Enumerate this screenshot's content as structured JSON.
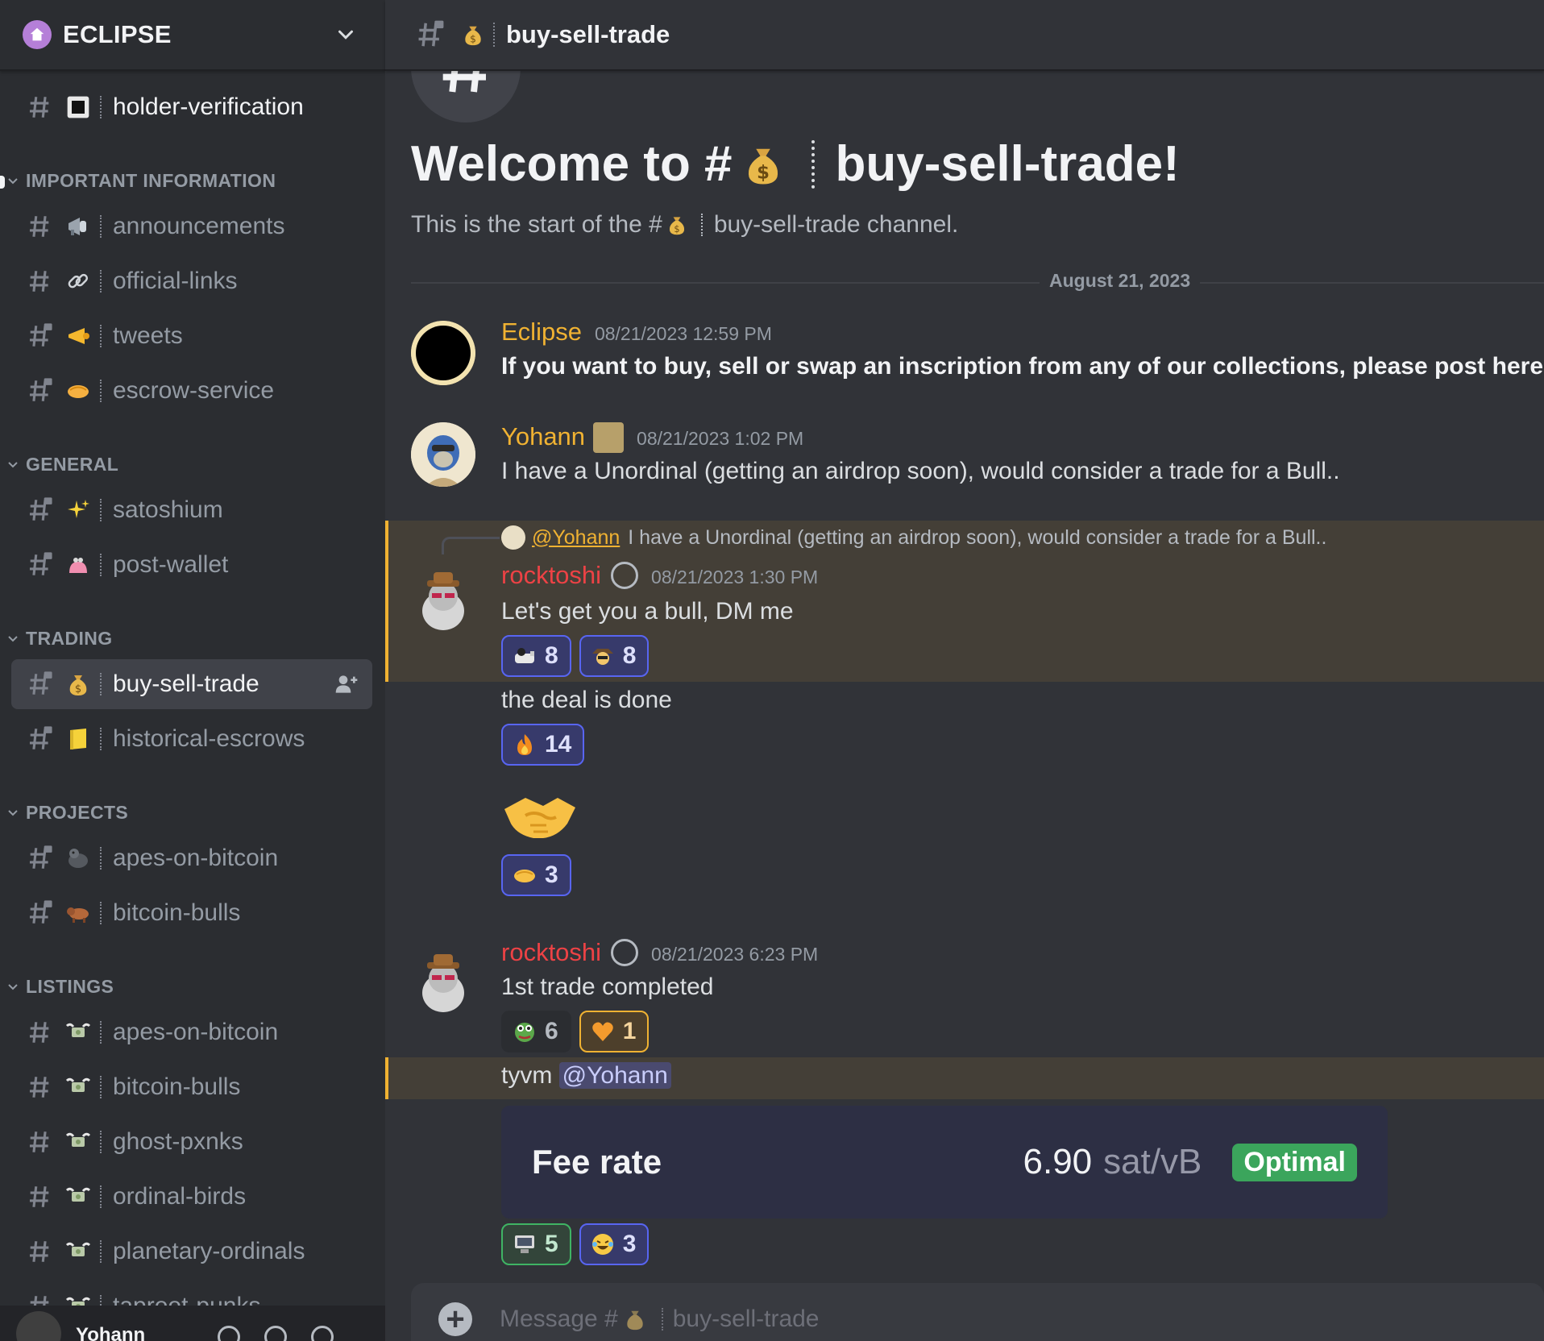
{
  "server": {
    "name": "ECLIPSE"
  },
  "sidebar": {
    "top_channel": {
      "label": "holder-verification"
    },
    "categories": [
      {
        "label": "IMPORTANT INFORMATION",
        "channels": [
          {
            "label": "announcements",
            "icon": "megaphone-icon"
          },
          {
            "label": "official-links",
            "icon": "link-icon"
          },
          {
            "label": "tweets",
            "icon": "horn-icon"
          },
          {
            "label": "escrow-service",
            "icon": "handshake-icon"
          }
        ]
      },
      {
        "label": "GENERAL",
        "channels": [
          {
            "label": "satoshium",
            "icon": "sparkles-icon"
          },
          {
            "label": "post-wallet",
            "icon": "purse-icon"
          }
        ]
      },
      {
        "label": "TRADING",
        "channels": [
          {
            "label": "buy-sell-trade",
            "icon": "money-bag-icon",
            "active": true
          },
          {
            "label": "historical-escrows",
            "icon": "ledger-icon"
          }
        ]
      },
      {
        "label": "PROJECTS",
        "channels": [
          {
            "label": "apes-on-bitcoin",
            "icon": "gorilla-icon"
          },
          {
            "label": "bitcoin-bulls",
            "icon": "ox-icon"
          }
        ]
      },
      {
        "label": "LISTINGS",
        "channels": [
          {
            "label": "apes-on-bitcoin",
            "icon": "flying-money-icon"
          },
          {
            "label": "bitcoin-bulls",
            "icon": "flying-money-icon"
          },
          {
            "label": "ghost-pxnks",
            "icon": "flying-money-icon"
          },
          {
            "label": "ordinal-birds",
            "icon": "flying-money-icon"
          },
          {
            "label": "planetary-ordinals",
            "icon": "flying-money-icon"
          },
          {
            "label": "taproot-punks",
            "icon": "flying-money-icon"
          }
        ]
      }
    ]
  },
  "user_panel": {
    "username": "Yohann"
  },
  "channel": {
    "name": "buy-sell-trade"
  },
  "welcome": {
    "title_prefix": "Welcome to #",
    "title_name": "buy-sell-trade!",
    "sub_prefix": "This is the start of the #",
    "sub_suffix": "buy-sell-trade channel."
  },
  "date_divider": "August 21, 2023",
  "messages": [
    {
      "author": "Eclipse",
      "timestamp": "08/21/2023 12:59 PM",
      "text": "If you want to buy, sell or swap an inscription from any of our collections, please post here."
    },
    {
      "author": "Yohann",
      "timestamp": "08/21/2023 1:02 PM",
      "text": "I have a Unordinal (getting an airdrop soon), would consider a trade for a Bull.."
    },
    {
      "author": "rocktoshi",
      "timestamp": "08/21/2023 1:30 PM",
      "reply_to": "@Yohann",
      "reply_text": "I have a Unordinal (getting an airdrop soon), would consider a trade for a Bull..",
      "text": "Let's get you a bull, DM me",
      "reactions": [
        {
          "emoji": "ape-emoji",
          "count": "8"
        },
        {
          "emoji": "cowboy-emoji",
          "count": "8"
        }
      ]
    },
    {
      "text": "the deal is done",
      "reactions": [
        {
          "emoji": "fire-emoji",
          "count": "14"
        }
      ]
    },
    {
      "emoji_only": "handshake-emoji",
      "reactions": [
        {
          "emoji": "handshake-emoji",
          "count": "3"
        }
      ]
    },
    {
      "author": "rocktoshi",
      "timestamp": "08/21/2023 6:23 PM",
      "text": "1st trade completed",
      "reactions": [
        {
          "emoji": "pepe-emoji",
          "count": "6"
        },
        {
          "emoji": "orange-heart-emoji",
          "count": "1"
        }
      ]
    },
    {
      "text_prefix": "tyvm ",
      "mention": "@Yohann"
    }
  ],
  "embed": {
    "label": "Fee rate",
    "value": "6.90",
    "unit": "sat/vB",
    "badge": "Optimal"
  },
  "embed_reactions": [
    {
      "emoji": "computer-emoji",
      "count": "5"
    },
    {
      "emoji": "laughing-emoji",
      "count": "3"
    }
  ],
  "composer": {
    "placeholder_prefix": "Message #",
    "placeholder_name": "buy-sell-trade"
  },
  "colors": {
    "accent": "#5865f2",
    "author_eclipse": "#f0b232",
    "author_yohann": "#f0b232",
    "author_rocktoshi": "#ed4245",
    "highlight": "#f0b232",
    "optimal": "#3ba55c"
  }
}
